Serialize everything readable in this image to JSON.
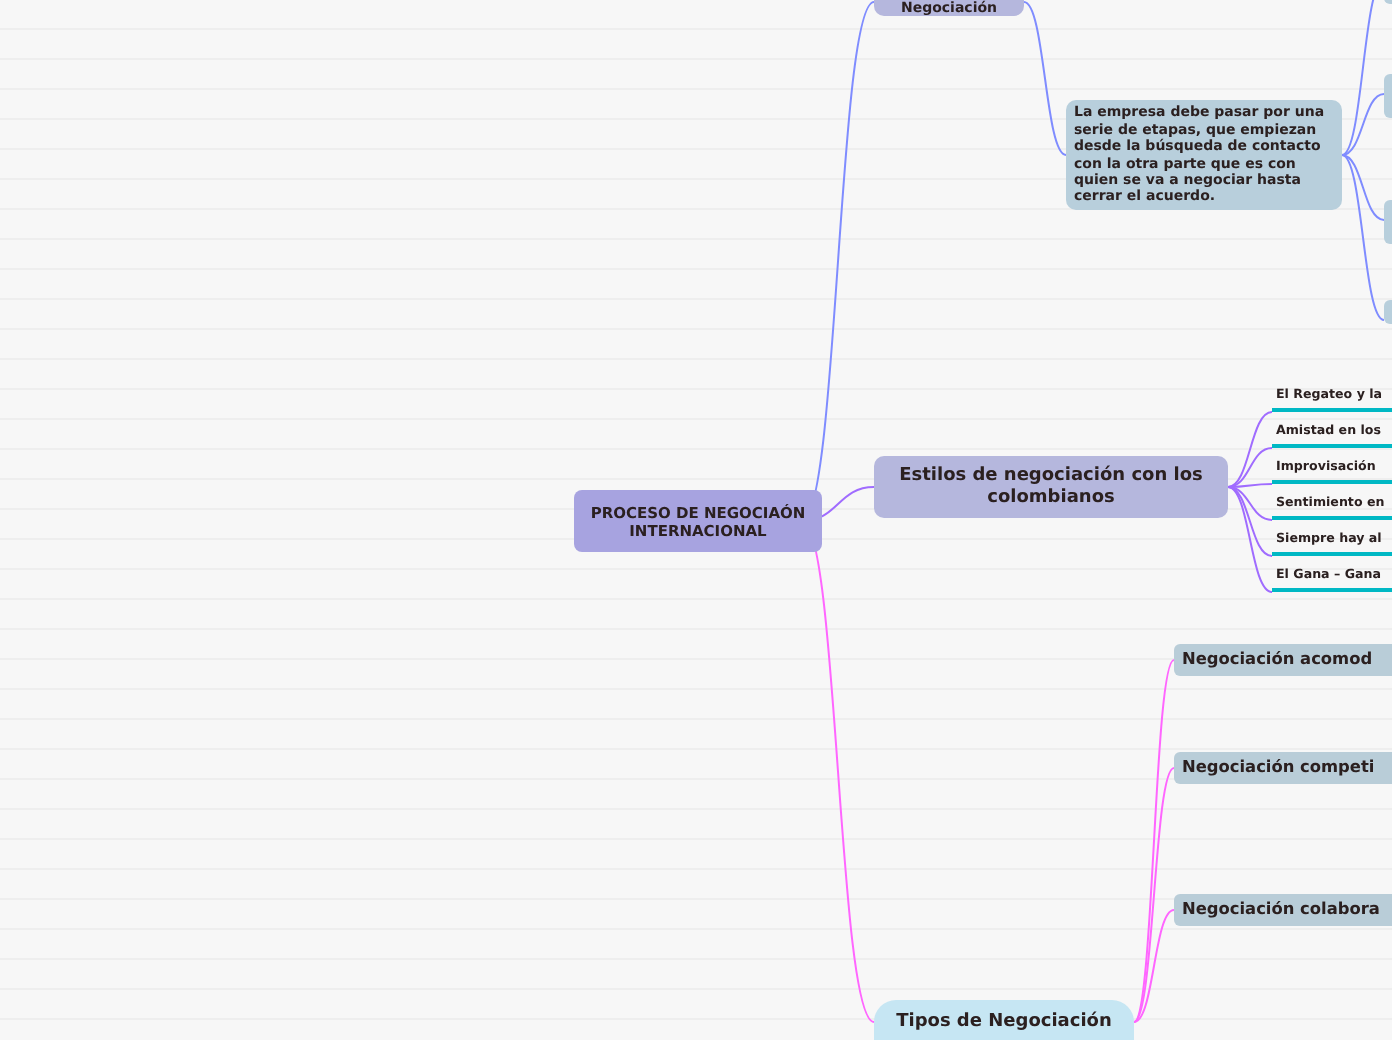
{
  "mind_map": {
    "root": {
      "text": "PROCESO DE NEGOCIAÓN INTERNACIONAL",
      "children": [
        {
          "text": "Negociación",
          "children": [
            {
              "text": "La empresa debe pasar por una serie de etapas, que empiezan desde la búsqueda de contacto con la otra parte que es con quien se va a negociar hasta cerrar el acuerdo."
            }
          ]
        },
        {
          "text": "Estilos de negociación con los colombianos",
          "children": [
            {
              "text": "El Regateo y la"
            },
            {
              "text": "Amistad en los"
            },
            {
              "text": "Improvisación"
            },
            {
              "text": "Sentimiento en"
            },
            {
              "text": "Siempre hay al"
            },
            {
              "text": "El Gana – Gana"
            }
          ]
        },
        {
          "text": "Tipos de Negociación",
          "children": [
            {
              "text": "Negociación acomod"
            },
            {
              "text": "Negociación competi"
            },
            {
              "text": "Negociación colabora"
            }
          ]
        }
      ]
    }
  }
}
